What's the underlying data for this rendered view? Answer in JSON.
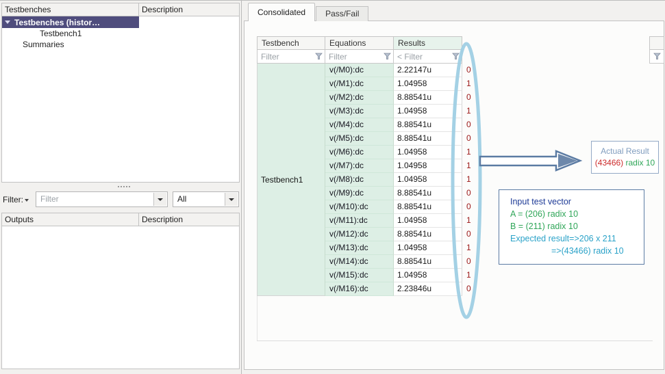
{
  "window": {
    "left": {
      "testbench_list": {
        "col1_header": "Testbenches",
        "col2_header": "Description",
        "tree": [
          {
            "label": "Testbenches (histor…",
            "selected": true
          },
          {
            "label": "Testbench1",
            "selected": false
          },
          {
            "label": "Summaries",
            "selected": false
          }
        ]
      },
      "filter_bar": {
        "label": "Filter:",
        "filter_placeholder": "Filter",
        "scope_value": "All"
      },
      "outputs_list": {
        "col1_header": "Outputs",
        "col2_header": "Description"
      }
    },
    "tabs": [
      {
        "label": "Consolidated",
        "active": true
      },
      {
        "label": "Pass/Fail",
        "active": false
      }
    ],
    "results_table": {
      "columns": [
        "Testbench",
        "Equations",
        "Results"
      ],
      "filter_placeholders": [
        "Filter",
        "Filter",
        "< Filter"
      ],
      "testbench_name": "Testbench1",
      "rows": [
        {
          "equation": "v(/M0):dc",
          "result": "2.22147u",
          "bit": "0"
        },
        {
          "equation": "v(/M1):dc",
          "result": "1.04958",
          "bit": "1"
        },
        {
          "equation": "v(/M2):dc",
          "result": "8.88541u",
          "bit": "0"
        },
        {
          "equation": "v(/M3):dc",
          "result": "1.04958",
          "bit": "1"
        },
        {
          "equation": "v(/M4):dc",
          "result": "8.88541u",
          "bit": "0"
        },
        {
          "equation": "v(/M5):dc",
          "result": "8.88541u",
          "bit": "0"
        },
        {
          "equation": "v(/M6):dc",
          "result": "1.04958",
          "bit": "1"
        },
        {
          "equation": "v(/M7):dc",
          "result": "1.04958",
          "bit": "1"
        },
        {
          "equation": "v(/M8):dc",
          "result": "1.04958",
          "bit": "1"
        },
        {
          "equation": "v(/M9):dc",
          "result": "8.88541u",
          "bit": "0"
        },
        {
          "equation": "v(/M10):dc",
          "result": "8.88541u",
          "bit": "0"
        },
        {
          "equation": "v(/M11):dc",
          "result": "1.04958",
          "bit": "1"
        },
        {
          "equation": "v(/M12):dc",
          "result": "8.88541u",
          "bit": "0"
        },
        {
          "equation": "v(/M13):dc",
          "result": "1.04958",
          "bit": "1"
        },
        {
          "equation": "v(/M14):dc",
          "result": "8.88541u",
          "bit": "0"
        },
        {
          "equation": "v(/M15):dc",
          "result": "1.04958",
          "bit": "1"
        },
        {
          "equation": "v(/M16):dc",
          "result": "2.23846u",
          "bit": "0"
        }
      ]
    },
    "annotations": {
      "actual_result": {
        "title": "Actual Result",
        "value": "(43466)",
        "suffix": " radix 10"
      },
      "input_vector": {
        "title": "Input test vector",
        "line_a": "A = (206) radix 10",
        "line_b": "B = (211) radix 10",
        "expected_line1": "Expected result=>206 x 211",
        "expected_line2": "=>(43466) radix 10"
      }
    },
    "colors": {
      "selection_bg": "#4f4d7d",
      "cell_green": "#ddefe5",
      "results_header_green": "#e7f3ec",
      "bit_red": "#9b1717",
      "ellipse_blue": "#9fcfe4",
      "arrow_slate": "#5b7ba3",
      "actual_title_blue": "#7f9cbe",
      "value_red": "#cc2a2a",
      "text_green": "#2fa658",
      "text_cyan": "#2aa2c8",
      "title_navy": "#1d3a96"
    }
  }
}
